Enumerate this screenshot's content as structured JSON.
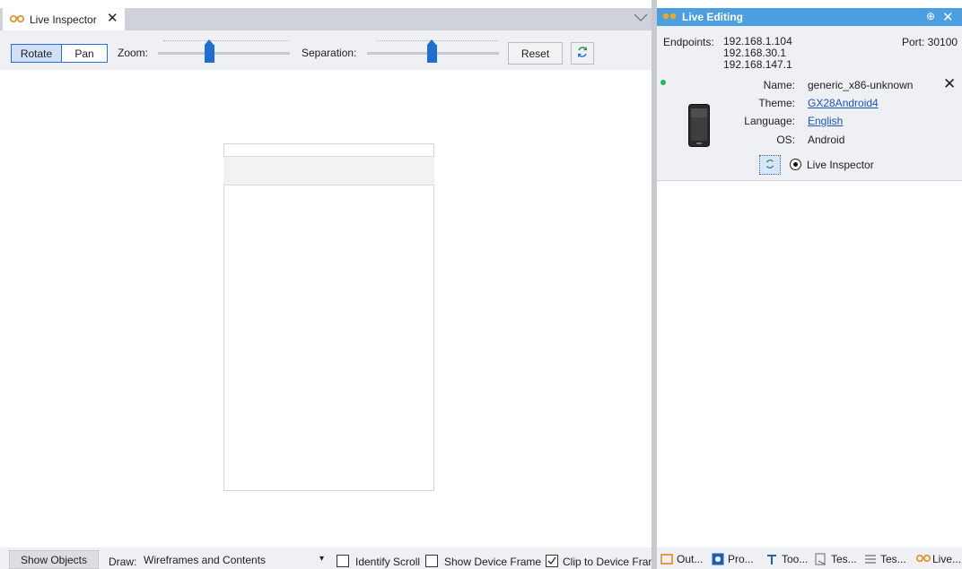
{
  "document_tab": {
    "title": "Live Inspector",
    "close_glyph": "✕",
    "icon": "glasses-icon",
    "overflow_icon": "chevron-down-icon"
  },
  "toolbar": {
    "rotate_label": "Rotate",
    "pan_label": "Pan",
    "zoom_label": "Zoom:",
    "zoom_value": 0.4,
    "separation_label": "Separation:",
    "separation_value": 0.5,
    "reset_label": "Reset",
    "refresh_icon": "refresh-icon"
  },
  "bottom_bar": {
    "show_objects_label": "Show Objects",
    "draw_label": "Draw:",
    "draw_value": "Wireframes and Contents",
    "identify_scroll_label": "Identify Scroll",
    "identify_scroll_checked": false,
    "show_device_frame_label": "Show Device Frame",
    "show_device_frame_checked": false,
    "clip_label": "Clip to Device Fram",
    "clip_checked": true
  },
  "live_editing": {
    "title": "Live Editing",
    "pin_glyph": "⊕",
    "close_glyph": "✕",
    "endpoints_label": "Endpoints:",
    "endpoints": [
      "192.168.1.104",
      "192.168.30.1",
      "192.168.147.1"
    ],
    "port_label": "Port: 30100",
    "device": {
      "status_color": "#1db954",
      "name_label": "Name:",
      "name_value": "generic_x86-unknown",
      "theme_label": "Theme:",
      "theme_value": "GX28Android4",
      "language_label": "Language:",
      "language_value": "English",
      "os_label": "OS:",
      "os_value": "Android",
      "remove_glyph": "✕",
      "live_inspector_label": "Live Inspector",
      "live_inspector_selected": true
    }
  },
  "tool_tabs": [
    {
      "label": "Out...",
      "icon": "output-icon"
    },
    {
      "label": "Pro...",
      "icon": "properties-icon"
    },
    {
      "label": "Too...",
      "icon": "toolbox-icon"
    },
    {
      "label": "Tes...",
      "icon": "test-icon"
    },
    {
      "label": "Tes...",
      "icon": "test-list-icon"
    },
    {
      "label": "Live...",
      "icon": "glasses-icon"
    }
  ],
  "colors": {
    "accent": "#1f6fd1",
    "panel_header": "#4b9ee0",
    "link": "#1a55c7"
  }
}
